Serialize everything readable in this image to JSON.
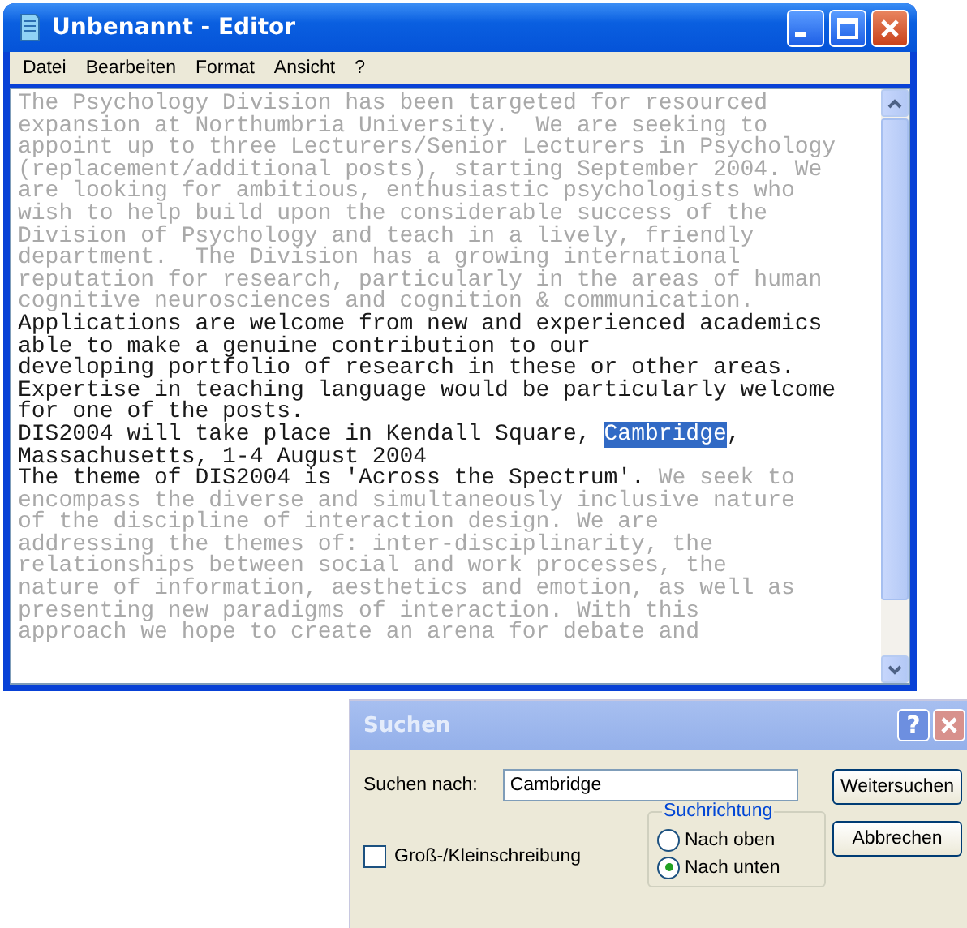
{
  "window": {
    "title": "Unbenannt - Editor"
  },
  "menu": [
    "Datei",
    "Bearbeiten",
    "Format",
    "Ansicht",
    "?"
  ],
  "lines": [
    [
      {
        "text": "The Psychology Division has been targeted for resourced",
        "faded": true,
        "selected": false
      }
    ],
    [
      {
        "text": "expansion at Northumbria University.  We are seeking to",
        "faded": true,
        "selected": false
      }
    ],
    [
      {
        "text": "appoint up to three Lecturers/Senior Lecturers in Psychology",
        "faded": true,
        "selected": false
      }
    ],
    [
      {
        "text": "(replacement/additional posts), starting September 2004. We",
        "faded": true,
        "selected": false
      }
    ],
    [
      {
        "text": "are looking for ambitious, enthusiastic psychologists who",
        "faded": true,
        "selected": false
      }
    ],
    [
      {
        "text": "wish to help build upon the considerable success of the",
        "faded": true,
        "selected": false
      }
    ],
    [
      {
        "text": "Division of Psychology and teach in a lively, friendly",
        "faded": true,
        "selected": false
      }
    ],
    [
      {
        "text": "department.  The Division has a growing international",
        "faded": true,
        "selected": false
      }
    ],
    [
      {
        "text": "reputation for research, particularly in the areas of human",
        "faded": true,
        "selected": false
      }
    ],
    [
      {
        "text": "cognitive neurosciences and cognition & communication.",
        "faded": true,
        "selected": false
      }
    ],
    [
      {
        "text": "Applications are welcome from new and experienced academics",
        "faded": false,
        "selected": false
      }
    ],
    [
      {
        "text": "able to make a genuine contribution to our",
        "faded": false,
        "selected": false
      }
    ],
    [
      {
        "text": "developing portfolio of research in these or other areas.",
        "faded": false,
        "selected": false
      }
    ],
    [
      {
        "text": "Expertise in teaching language would be particularly welcome",
        "faded": false,
        "selected": false
      }
    ],
    [
      {
        "text": "for one of the posts.",
        "faded": false,
        "selected": false
      }
    ],
    [
      {
        "text": "DIS2004 will take place in Kendall Square, ",
        "faded": false,
        "selected": false
      },
      {
        "text": "Cambridge",
        "faded": false,
        "selected": true
      },
      {
        "text": ",",
        "faded": false,
        "selected": false
      }
    ],
    [
      {
        "text": "Massachusetts, 1-4 August 2004",
        "faded": false,
        "selected": false
      }
    ],
    [
      {
        "text": "The theme of DIS2004 is 'Across the Spectrum'.",
        "faded": false,
        "selected": false
      },
      {
        "text": " We seek to",
        "faded": true,
        "selected": false
      }
    ],
    [
      {
        "text": "encompass the diverse and simultaneously inclusive nature",
        "faded": true,
        "selected": false
      }
    ],
    [
      {
        "text": "of the discipline of interaction design. We are",
        "faded": true,
        "selected": false
      }
    ],
    [
      {
        "text": "addressing the themes of: inter-disciplinarity, the",
        "faded": true,
        "selected": false
      }
    ],
    [
      {
        "text": "relationships between social and work processes, the",
        "faded": true,
        "selected": false
      }
    ],
    [
      {
        "text": "nature of information, aesthetics and emotion, as well as",
        "faded": true,
        "selected": false
      }
    ],
    [
      {
        "text": "presenting new paradigms of interaction. With this",
        "faded": true,
        "selected": false
      }
    ],
    [
      {
        "text": "approach we hope to create an arena for debate and",
        "faded": true,
        "selected": false
      }
    ]
  ],
  "dialog": {
    "title": "Suchen",
    "help": "?",
    "search_label": "Suchen nach:",
    "search_value": "Cambridge",
    "buttons": [
      "Weitersuchen",
      "Abbrechen"
    ],
    "case": {
      "label": "Groß-/Kleinschreibung",
      "checked": false
    },
    "direction": {
      "label": "Suchrichtung",
      "options": [
        {
          "label": "Nach oben",
          "selected": false
        },
        {
          "label": "Nach unten",
          "selected": true
        }
      ]
    }
  }
}
